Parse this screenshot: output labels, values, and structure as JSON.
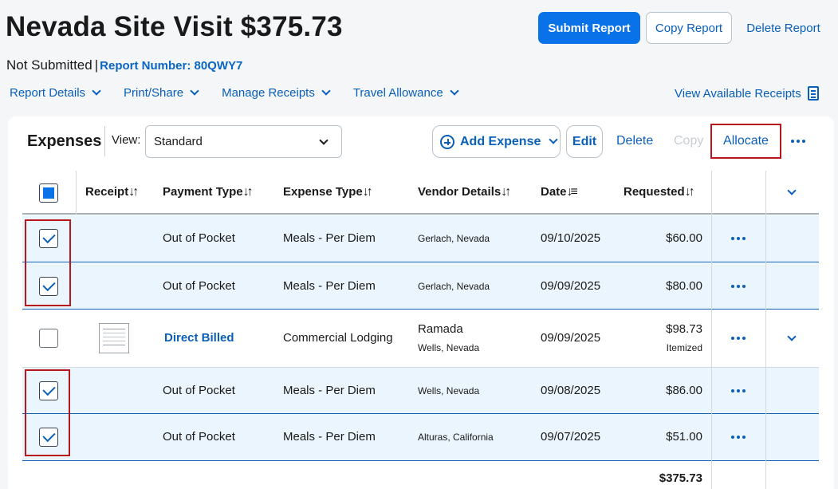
{
  "report": {
    "title": "Nevada Site Visit $375.73",
    "status": "Not Submitted",
    "separator": "|",
    "report_number": "Report Number: 80QWY7"
  },
  "actions": {
    "submit": "Submit Report",
    "copy": "Copy Report",
    "delete": "Delete Report"
  },
  "menu": {
    "items": [
      {
        "label": "Report Details"
      },
      {
        "label": "Print/Share"
      },
      {
        "label": "Manage Receipts"
      },
      {
        "label": "Travel Allowance"
      }
    ],
    "view_receipts": "View Available Receipts"
  },
  "expenses": {
    "title": "Expenses",
    "view_label": "View:",
    "view_value": "Standard",
    "add_expense": "Add Expense",
    "edit": "Edit",
    "delete": "Delete",
    "copy": "Copy",
    "allocate": "Allocate"
  },
  "table": {
    "headers": {
      "receipt": "Receipt",
      "payment_type": "Payment Type",
      "expense_type": "Expense Type",
      "vendor": "Vendor Details",
      "date": "Date",
      "requested": "Requested"
    },
    "rows": [
      {
        "checked": true,
        "payment": "Out of Pocket",
        "expense": "Meals - Per Diem",
        "vendor": "",
        "location": "Gerlach, Nevada",
        "date": "09/10/2025",
        "amount": "$60.00",
        "sub": ""
      },
      {
        "checked": true,
        "payment": "Out of Pocket",
        "expense": "Meals - Per Diem",
        "vendor": "",
        "location": "Gerlach, Nevada",
        "date": "09/09/2025",
        "amount": "$80.00",
        "sub": ""
      },
      {
        "checked": false,
        "payment": "Direct Billed",
        "expense": "Commercial Lodging",
        "vendor": "Ramada",
        "location": "Wells, Nevada",
        "date": "09/09/2025",
        "amount": "$98.73",
        "sub": "Itemized"
      },
      {
        "checked": true,
        "payment": "Out of Pocket",
        "expense": "Meals - Per Diem",
        "vendor": "",
        "location": "Wells, Nevada",
        "date": "09/08/2025",
        "amount": "$86.00",
        "sub": ""
      },
      {
        "checked": true,
        "payment": "Out of Pocket",
        "expense": "Meals - Per Diem",
        "vendor": "",
        "location": "Alturas, California",
        "date": "09/07/2025",
        "amount": "$51.00",
        "sub": ""
      }
    ],
    "total": "$375.73"
  },
  "colors": {
    "accent": "#0a72e8",
    "link": "#0a5fb8",
    "selected_row": "#eaf5fd",
    "highlight_box": "#b7161c"
  }
}
